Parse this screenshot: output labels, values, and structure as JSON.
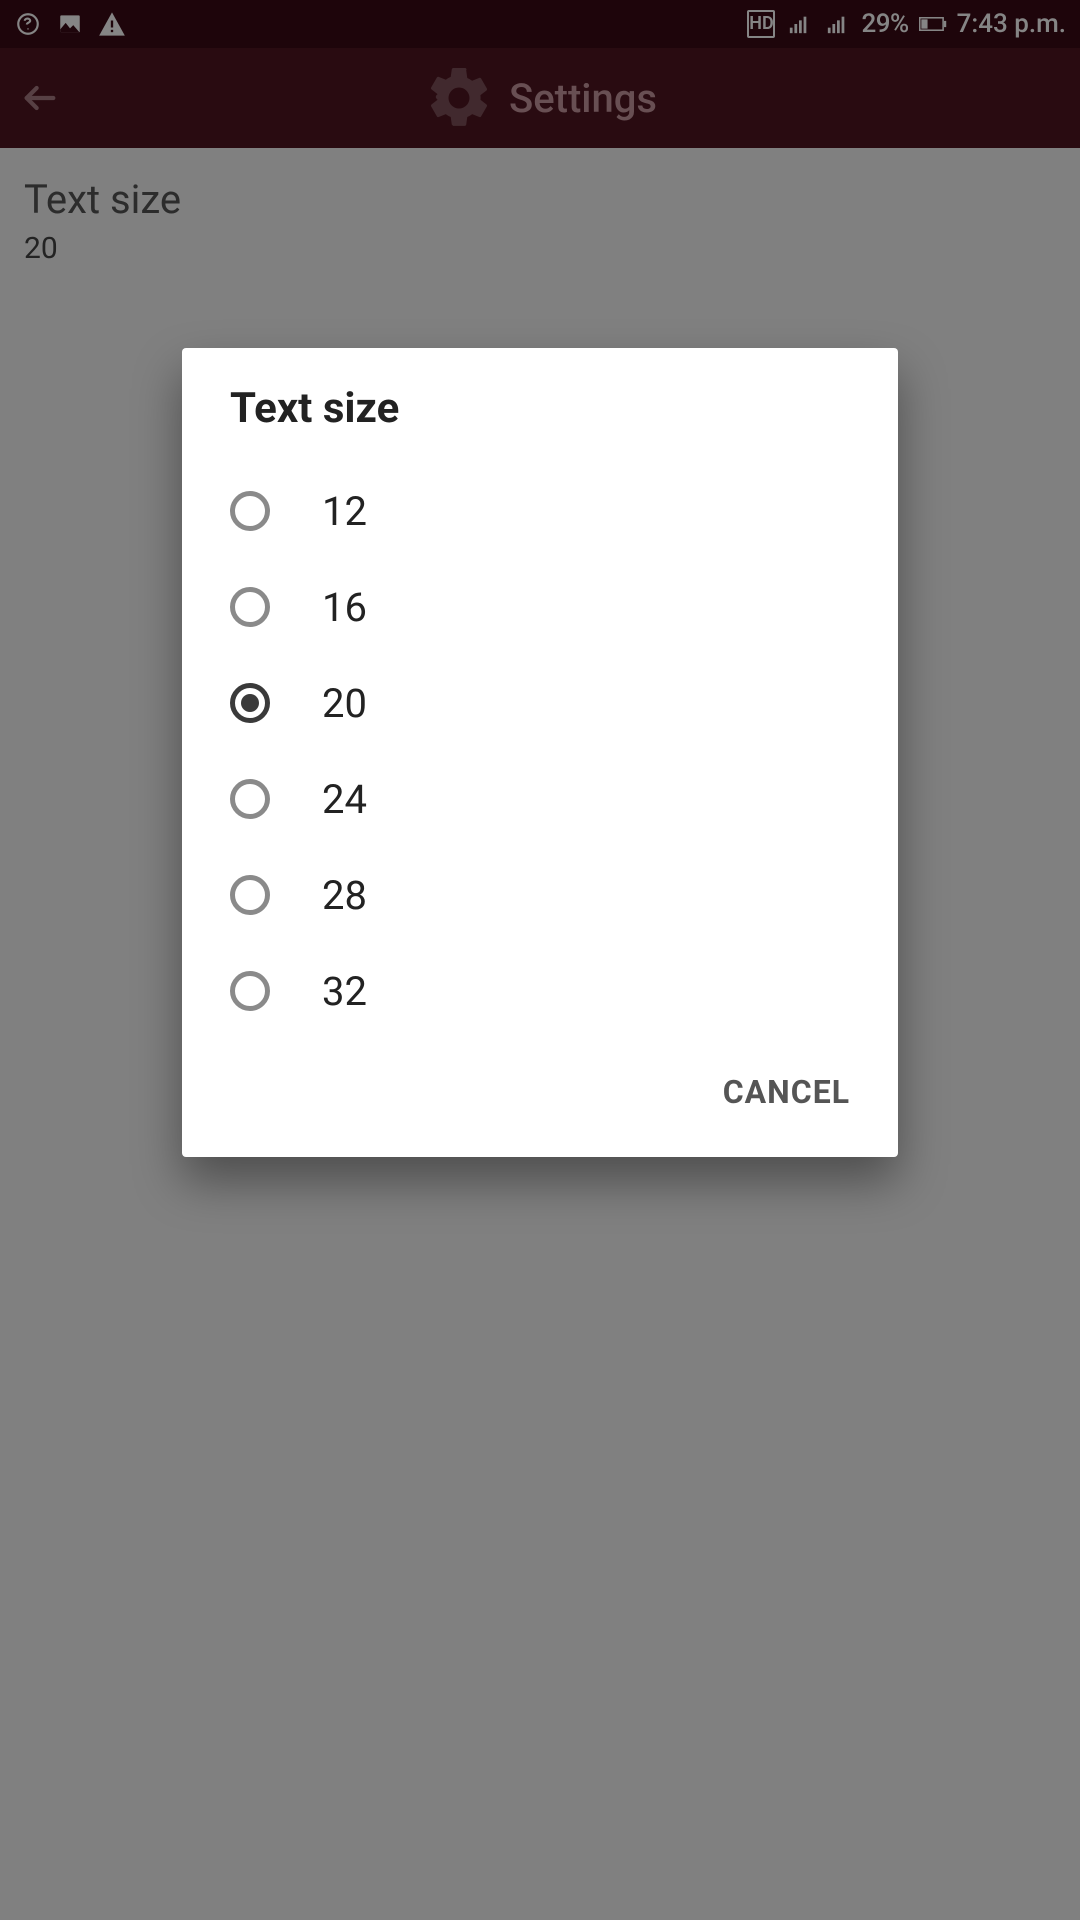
{
  "status_bar": {
    "battery_pct": "29%",
    "time": "7:43 p.m.",
    "hd_label": "HD"
  },
  "app_bar": {
    "title": "Settings"
  },
  "setting": {
    "title": "Text size",
    "value": "20"
  },
  "dialog": {
    "title": "Text size",
    "cancel_label": "CANCEL",
    "options": [
      {
        "label": "12",
        "selected": false
      },
      {
        "label": "16",
        "selected": false
      },
      {
        "label": "20",
        "selected": true
      },
      {
        "label": "24",
        "selected": false
      },
      {
        "label": "28",
        "selected": false
      },
      {
        "label": "32",
        "selected": false
      }
    ]
  }
}
